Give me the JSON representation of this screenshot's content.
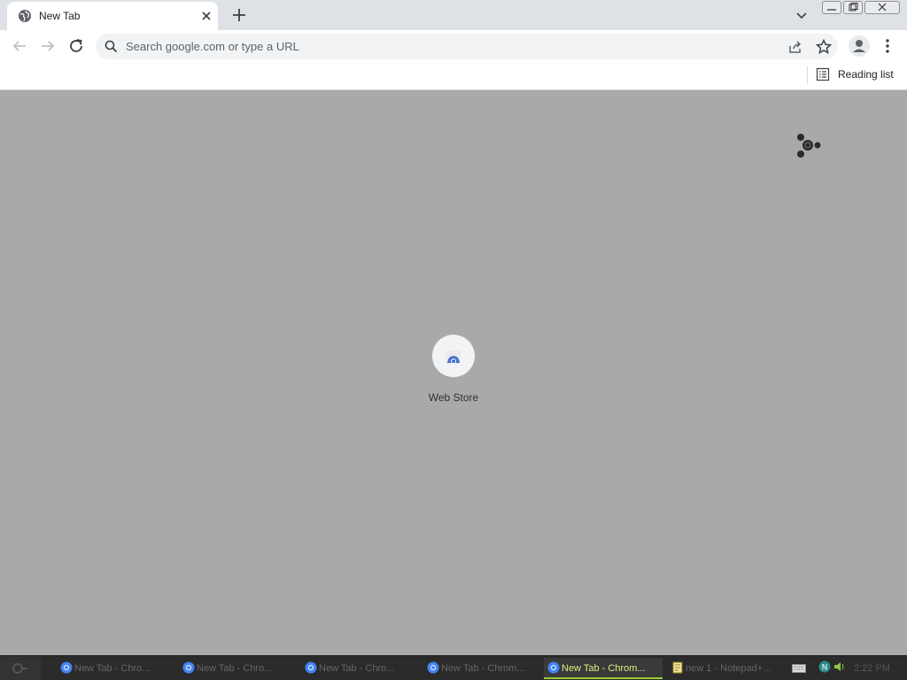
{
  "tab": {
    "title": "New Tab"
  },
  "omnibox": {
    "placeholder": "Search google.com or type a URL"
  },
  "bookmarks": {
    "reading_list_label": "Reading list"
  },
  "content": {
    "shortcuts": [
      {
        "label": "Web Store"
      }
    ]
  },
  "taskbar": {
    "items": [
      {
        "label": "New Tab - Chro..."
      },
      {
        "label": "New Tab - Chro..."
      },
      {
        "label": "New Tab - Chro..."
      },
      {
        "label": "New Tab - Chrom..."
      },
      {
        "label": "New Tab - Chrom..."
      },
      {
        "label": "new 1 - Notepad+..."
      }
    ],
    "clock": "2:22 PM"
  },
  "colors": {
    "tabstrip": "#dee1e6",
    "content_bg": "#a9a9a9",
    "taskbar_active": "#9acd32"
  },
  "icons": [
    "globe-icon",
    "close-icon",
    "plus-icon",
    "chevron-down-icon",
    "back-arrow-icon",
    "forward-arrow-icon",
    "reload-icon",
    "search-icon",
    "share-icon",
    "star-icon",
    "profile-icon",
    "kebab-menu-icon",
    "reading-list-icon",
    "customize-icon",
    "web-store-icon",
    "start-icon",
    "chrome-icon",
    "notepad-icon",
    "keyboard-icon",
    "network-icon",
    "volume-icon"
  ]
}
